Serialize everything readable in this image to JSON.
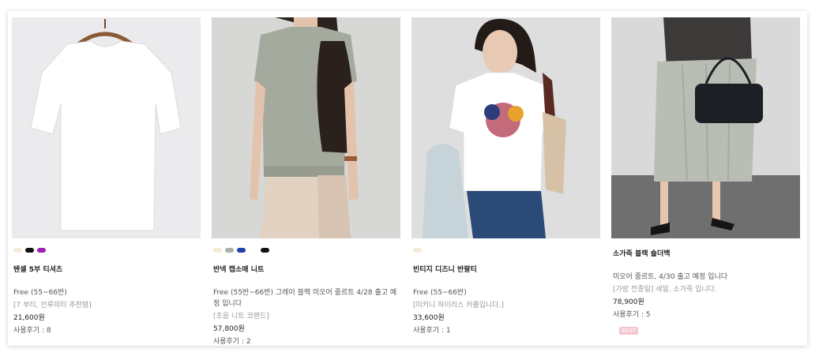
{
  "products": [
    {
      "name": "텐셀 5부 티셔츠",
      "size": "Free (55~66반)",
      "note": "[7 부티, 언루미티 추천템]",
      "price": "21,600원",
      "reviews": "사용후기 : 8",
      "swatch_colors": [
        "#f6ecd6",
        "#111111",
        "#9b1fb5"
      ]
    },
    {
      "name": "반넥 캡소매 니트",
      "size": "Free (55반~66반) 그레이 블랙 미오어 중르트 4/28 출고 예정 입니다",
      "note": "[초음 니트 코랜드]",
      "price": "57,800원",
      "reviews": "사용후기 : 2",
      "swatch_colors": [
        "#f6ecd6",
        "#aab1a6",
        "#1f3fa6",
        "#ffffff",
        "#111111"
      ]
    },
    {
      "name": "빈티지 디즈니 반팔티",
      "size": "Free (55~66반)",
      "note": "[미키니 하이리스 커플입니다.]",
      "price": "33,600원",
      "reviews": "사용후기 : 1",
      "swatch_colors": [
        "#f6ecd6"
      ]
    },
    {
      "name": "소가죽 블랙 숄더백",
      "size": "미오어 중르트, 4/30 출고 예정 입니다",
      "note": "[가방 전종일] 세일, 소가죽 입니다.",
      "price": "78,900원",
      "reviews": "사용후기 : 5",
      "badge": "BEST",
      "swatch_colors": []
    }
  ]
}
